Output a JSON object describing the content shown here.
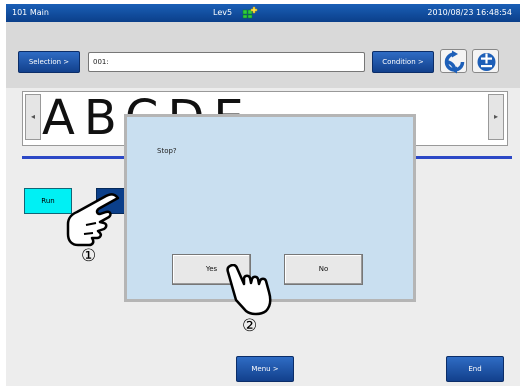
{
  "titlebar": {
    "left": "101 Main",
    "mid": "Lev5",
    "right": "2010/08/23 16:48:54",
    "icon": "grid-plus-icon"
  },
  "header": {
    "selection_label": "Selection >",
    "selection_value": "001:",
    "condition_label": "Condition >",
    "refresh_icon": "refresh-icon",
    "toggle_icon": "plus-minus-icon"
  },
  "preview": {
    "text": "ABCDE",
    "left_arrow": "◂",
    "right_arrow": "▸"
  },
  "controls": {
    "run_label": "Run"
  },
  "dialog": {
    "message": "Stop?",
    "yes_label": "Yes",
    "no_label": "No"
  },
  "annotations": {
    "step1": "①",
    "step2": "②",
    "icon": "pointing-hand-icon"
  },
  "footer": {
    "menu_label": "Menu >",
    "end_label": "End"
  }
}
